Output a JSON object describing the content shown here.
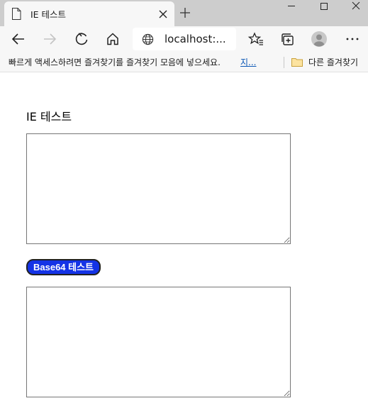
{
  "browser": {
    "tab": {
      "title": "IE 테스트",
      "icon": "document-icon"
    },
    "address": {
      "url": "localhost:..."
    },
    "favorites_bar": {
      "hint": "빠르게 액세스하려면 즐겨찾기를 즐겨찾기 모음에 넣으세요.",
      "link": "지...",
      "other_folder": "다른 즐겨찾기"
    }
  },
  "page": {
    "title": "IE 테스트",
    "input_textarea_value": "",
    "button_label": "Base64 테스트",
    "output_textarea_value": "",
    "button_color": "#1433e6"
  }
}
